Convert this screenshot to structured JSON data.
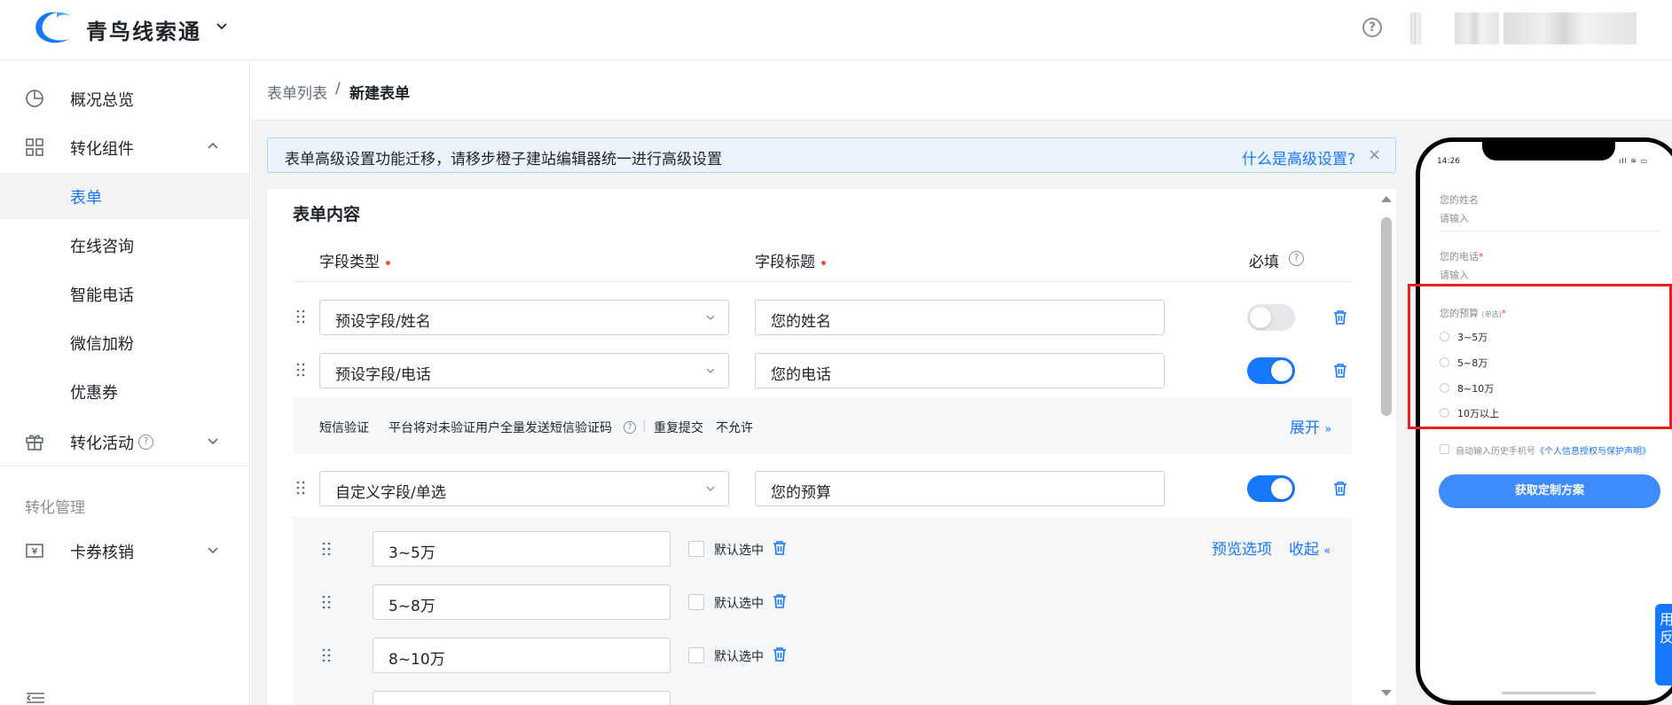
{
  "header": {
    "brand": "青鸟线索通",
    "help": "?"
  },
  "sidebar": {
    "items": [
      {
        "label": "概况总览"
      },
      {
        "label": "转化组件"
      },
      {
        "label": "表单"
      },
      {
        "label": "在线咨询"
      },
      {
        "label": "智能电话"
      },
      {
        "label": "微信加粉"
      },
      {
        "label": "优惠券"
      },
      {
        "label": "转化活动"
      },
      {
        "label": "转化管理"
      },
      {
        "label": "卡券核销"
      }
    ]
  },
  "breadcrumb": {
    "parent": "表单列表",
    "sep": "/",
    "current": "新建表单"
  },
  "notice": {
    "text": "表单高级设置功能迁移，请移步橙子建站编辑器统一进行高级设置",
    "link": "什么是高级设置?",
    "close": "×"
  },
  "form": {
    "title": "表单内容",
    "col_type": "字段类型",
    "col_title": "字段标题",
    "col_required": "必填",
    "help": "?",
    "rows": [
      {
        "type": "预设字段/姓名",
        "title": "您的姓名",
        "required": false
      },
      {
        "type": "预设字段/电话",
        "title": "您的电话",
        "required": true
      },
      {
        "type": "自定义字段/单选",
        "title": "您的预算",
        "required": true
      }
    ],
    "sms": {
      "label": "短信验证",
      "desc": "平台将对未验证用户全量发送短信验证码",
      "help": "?",
      "sep": "|",
      "resubmit": "重复提交",
      "resubmit_value": "不允许",
      "expand": "展开"
    },
    "options": {
      "preview": "预览选项",
      "collapse": "收起",
      "default_label": "默认选中",
      "items": [
        "3~5万",
        "5~8万",
        "8~10万"
      ]
    }
  },
  "phone": {
    "time": "14:26",
    "status": "ıll ≋ ▭",
    "name_label": "您的姓名",
    "name_ph": "请输入",
    "phone_label": "您的电话",
    "phone_star": "*",
    "phone_ph": "请输入",
    "budget_label": "您的预算",
    "budget_hint": "(单选)",
    "budget_star": "*",
    "budget_opts": [
      "3~5万",
      "5~8万",
      "8~10万",
      "10万以上"
    ],
    "agree_text": "自动输入历史手机号",
    "agree_link": "《个人信息授权与保护声明》",
    "submit": "获取定制方案"
  },
  "float_btn": "用反",
  "colors": {
    "primary": "#1677ff",
    "highlight": "#e8211c"
  }
}
